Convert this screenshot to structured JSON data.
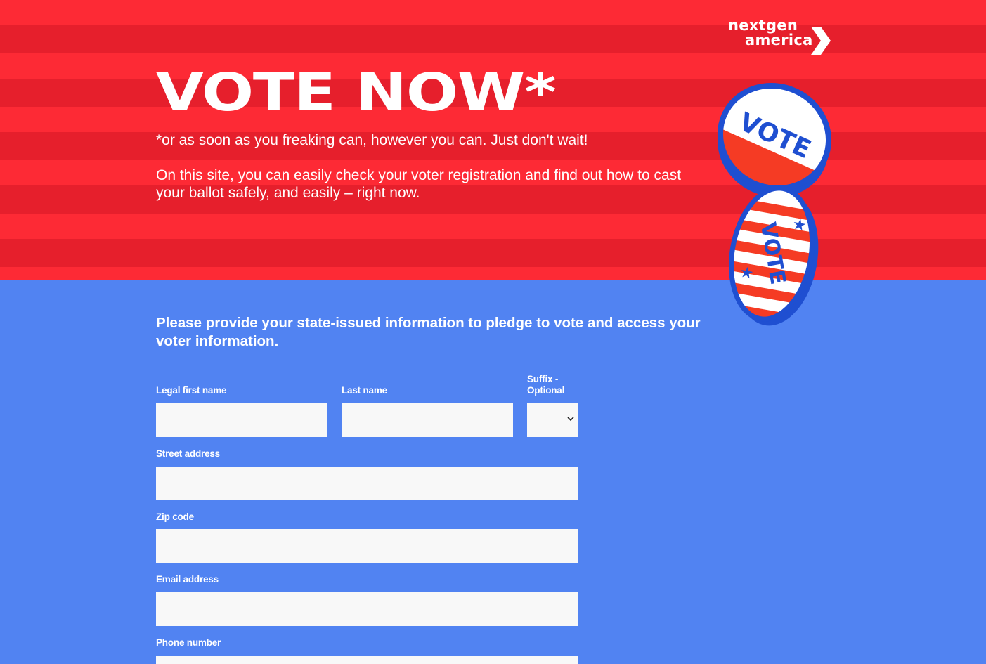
{
  "brand": {
    "logo_line1": "nextgen",
    "logo_line2": "america"
  },
  "hero": {
    "headline": "VOTE NOW*",
    "note": "*or as soon as you freaking can, however you can. Just don't wait!",
    "lead": "On this site, you can easily check your voter registration and find out how to cast your ballot safely, and easily – right now.",
    "badge_text": "VOTE"
  },
  "form": {
    "intro": "Please provide your state-issued information to pledge to vote and access your voter information.",
    "fields": {
      "first_name": {
        "label": "Legal first name",
        "value": ""
      },
      "last_name": {
        "label": "Last name",
        "value": ""
      },
      "suffix": {
        "label": "Suffix - Optional",
        "value": ""
      },
      "street": {
        "label": "Street address",
        "value": ""
      },
      "zip": {
        "label": "Zip code",
        "value": ""
      },
      "email": {
        "label": "Email address",
        "value": ""
      },
      "phone": {
        "label": "Phone number",
        "value": ""
      }
    }
  },
  "colors": {
    "red_light": "#fd2a35",
    "red_dark": "#e61f2c",
    "blue_bg": "#5183f2",
    "badge_blue": "#1f4fd1",
    "field_bg": "#f8f8f8"
  },
  "icons": [
    "chevron-right-icon",
    "chevron-down-icon",
    "vote-badge-icon"
  ]
}
